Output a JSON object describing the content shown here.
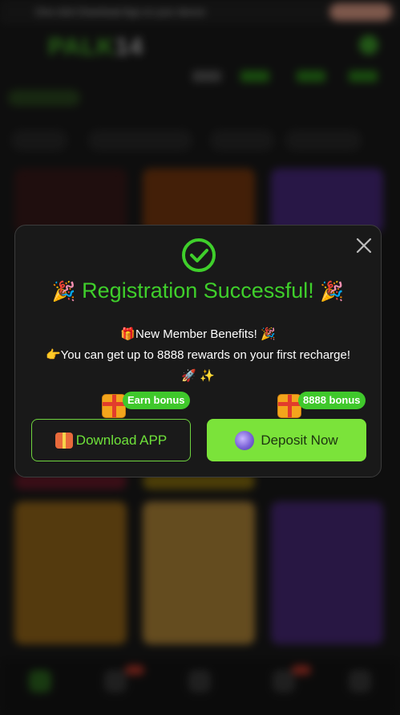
{
  "background": {
    "banner_text": "One-click Download App on your device",
    "banner_highlight": "Download"
  },
  "modal": {
    "title_emoji_left": "🎉",
    "title": "Registration Successful!",
    "title_emoji_right": "🎉",
    "benefit_icon": "🎁",
    "benefit_line_1": "New Member Benefits!",
    "benefit_emoji": "🎉",
    "hand_icon": "👉",
    "benefit_line_2": "You can get up to 8888 rewards on your first recharge!",
    "sparkle_emojis": "🚀 ✨",
    "download_tag": "Earn bonus",
    "deposit_tag": "8888 bonus",
    "download_label": "Download APP",
    "deposit_label": "Deposit Now"
  },
  "colors": {
    "accent_green": "#3fcf2b",
    "button_green": "#7be33a",
    "modal_bg": "#191919"
  },
  "icons": [
    "check-circle-icon",
    "close-icon",
    "gift-icon",
    "wallet-icon",
    "party-popper-icon",
    "pointing-hand-icon",
    "rocket-icon",
    "sparkles-icon"
  ]
}
